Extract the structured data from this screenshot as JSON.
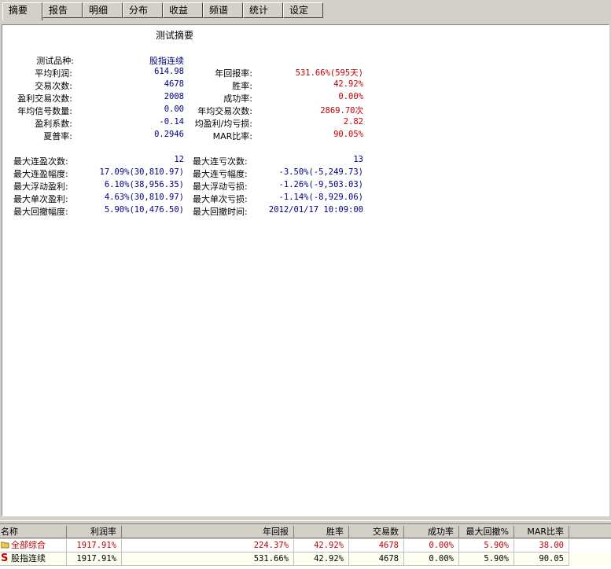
{
  "tabs": [
    "摘要",
    "报告",
    "明细",
    "分布",
    "收益",
    "频谱",
    "统计",
    "设定"
  ],
  "summary": {
    "title": "测试摘要",
    "product_label": "测试品种:",
    "product_value": "股指连续",
    "left": [
      {
        "label": "平均利润:",
        "value": "614.98"
      },
      {
        "label": "交易次数:",
        "value": "4678"
      },
      {
        "label": "盈利交易次数:",
        "value": "2008"
      },
      {
        "label": "年均信号数量:",
        "value": "0.00"
      },
      {
        "label": "盈利系数:",
        "value": "-0.14"
      },
      {
        "label": "夏普率:",
        "value": "0.2946"
      }
    ],
    "right": [
      {
        "label": "年回报率:",
        "value": "531.66%(595天)"
      },
      {
        "label": "胜率:",
        "value": "42.92%"
      },
      {
        "label": "成功率:",
        "value": "0.00%"
      },
      {
        "label": "年均交易次数:",
        "value": "2869.70次"
      },
      {
        "label": "均盈利/均亏损:",
        "value": "2.82"
      },
      {
        "label": "MAR比率:",
        "value": "90.05%"
      }
    ],
    "extremes_left": [
      {
        "label": "最大连盈次数:",
        "value": "12"
      },
      {
        "label": "最大连盈幅度:",
        "value": "17.09%(30,810.97)"
      },
      {
        "label": "最大浮动盈利:",
        "value": "6.10%(38,956.35)"
      },
      {
        "label": "最大单次盈利:",
        "value": "4.63%(30,810.97)"
      },
      {
        "label": "最大回撤幅度:",
        "value": "5.90%(10,476.50)"
      }
    ],
    "extremes_right": [
      {
        "label": "最大连亏次数:",
        "value": "13"
      },
      {
        "label": "最大连亏幅度:",
        "value": "-3.50%(-5,249.73)"
      },
      {
        "label": "最大浮动亏损:",
        "value": "-1.26%(-9,503.03)"
      },
      {
        "label": "最大单次亏损:",
        "value": "-1.14%(-8,929.06)"
      },
      {
        "label": "最大回撤时间:",
        "value": "2012/01/17 10:09:00"
      }
    ]
  },
  "table": {
    "headers": [
      "名称",
      "利润率",
      "",
      "年回报",
      "胜率",
      "交易数",
      "成功率",
      "最大回撤%",
      "MAR比率"
    ],
    "rows": [
      {
        "icon": "folder-icon",
        "cells": [
          "全部综合",
          "1917.91%",
          "",
          "224.37%",
          "42.92%",
          "4678",
          "0.00%",
          "5.90%",
          "38.00"
        ]
      },
      {
        "icon": "s-icon",
        "icon_text": "S",
        "cells": [
          "股指连续",
          "1917.91%",
          "",
          "531.66%",
          "42.92%",
          "4678",
          "0.00%",
          "5.90%",
          "90.05"
        ]
      }
    ]
  },
  "colors": {
    "value_blue": "#000080",
    "value_red": "#c00000",
    "window_bg": "#d4d0c8"
  }
}
